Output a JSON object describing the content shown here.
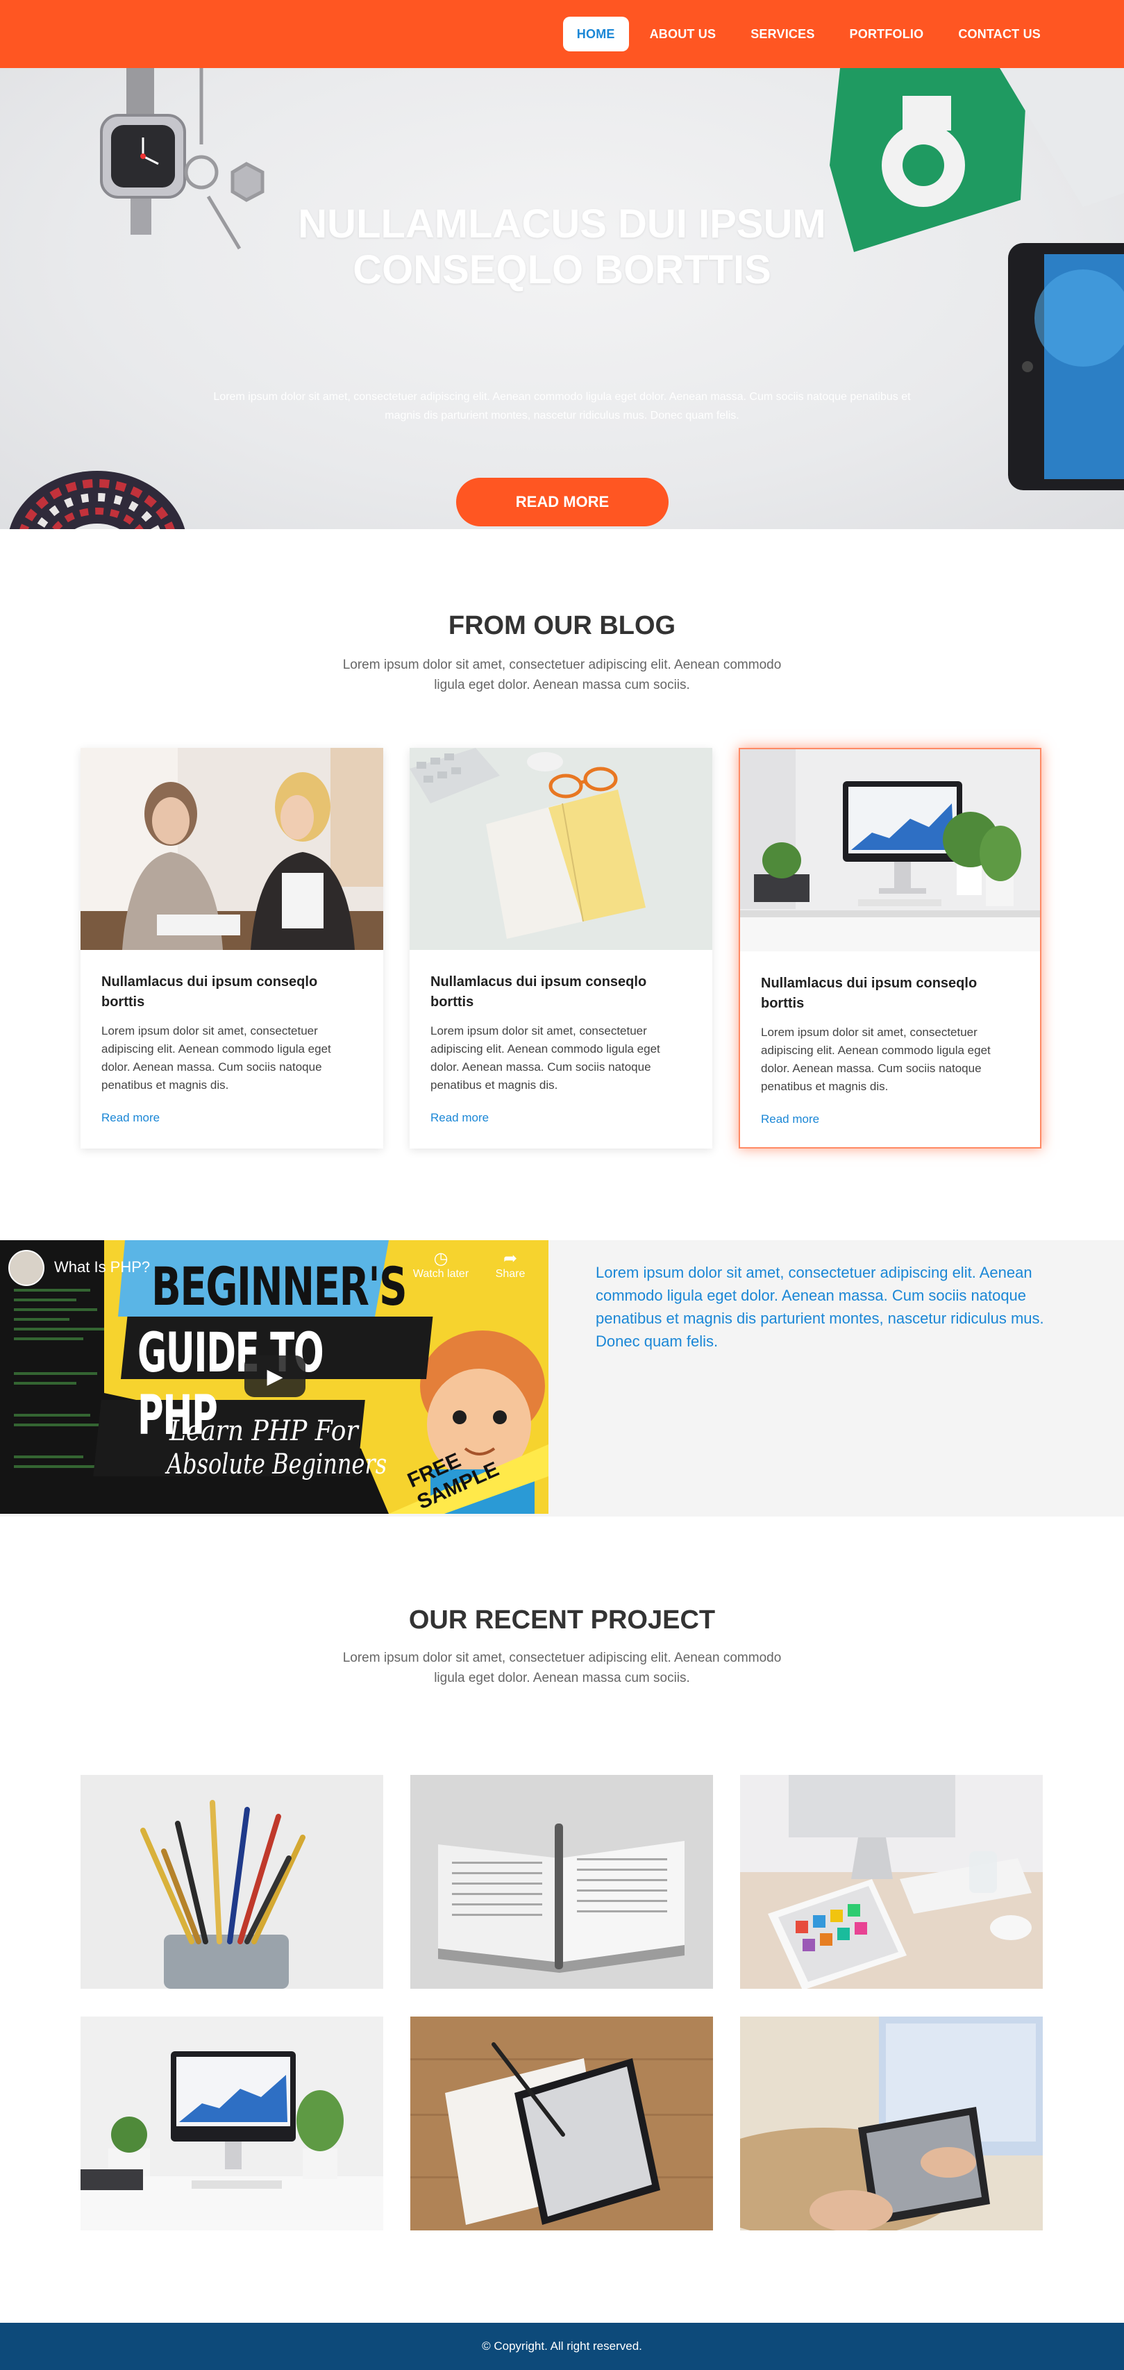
{
  "nav": {
    "items": [
      {
        "label": "HOME",
        "active": true
      },
      {
        "label": "ABOUT US"
      },
      {
        "label": "SERVICES"
      },
      {
        "label": "PORTFOLIO"
      },
      {
        "label": "CONTACT US"
      }
    ]
  },
  "hero": {
    "title_line1": "NULLAMLACUS DUI IPSUM",
    "title_line2": "CONSEQLO BORTTIS",
    "subtitle": "Lorem ipsum dolor sit amet, consectetuer adipiscing elit. Aenean commodo ligula eget dolor. Aenean massa. Cum sociis natoque penatibus et magnis dis parturient montes, nascetur ridiculus mus. Donec quam felis.",
    "button": "READ MORE"
  },
  "blog": {
    "title": "FROM OUR BLOG",
    "subtitle": "Lorem ipsum dolor sit amet, consectetuer adipiscing elit. Aenean commodo ligula eget dolor. Aenean massa cum sociis.",
    "cards": [
      {
        "title": "Nullamlacus dui ipsum conseqlo borttis",
        "text": "Lorem ipsum dolor sit amet, consectetuer adipiscing elit. Aenean commodo ligula eget dolor. Aenean massa. Cum sociis natoque penatibus et magnis dis.",
        "link": "Read more"
      },
      {
        "title": "Nullamlacus dui ipsum conseqlo borttis",
        "text": "Lorem ipsum dolor sit amet, consectetuer adipiscing elit. Aenean commodo ligula eget dolor. Aenean massa. Cum sociis natoque penatibus et magnis dis.",
        "link": "Read more"
      },
      {
        "title": "Nullamlacus dui ipsum conseqlo borttis",
        "text": "Lorem ipsum dolor sit amet, consectetuer adipiscing elit. Aenean commodo ligula eget dolor. Aenean massa. Cum sociis natoque penatibus et magnis dis.",
        "link": "Read more"
      }
    ]
  },
  "video": {
    "title": "What Is PHP?",
    "watch_later": "Watch later",
    "share": "Share",
    "thumb_line1": "BEGINNER'S",
    "thumb_line2": "GUIDE TO PHP",
    "thumb_script1": "Learn PHP For",
    "thumb_script2": "Absolute Beginners",
    "thumb_ribbon": "FREE SAMPLE",
    "description": "Lorem ipsum dolor sit amet, consectetuer adipiscing elit. Aenean commodo ligula eget dolor. Aenean massa. Cum sociis natoque penatibus et magnis dis parturient montes, nascetur ridiculus mus. Donec quam felis."
  },
  "projects": {
    "title": "OUR RECENT PROJECT",
    "subtitle": "Lorem ipsum dolor sit amet, consectetuer adipiscing elit. Aenean commodo ligula eget dolor. Aenean massa cum sociis."
  },
  "footer": {
    "copyright": "© Copyright. All right reserved."
  },
  "colors": {
    "accent": "#ff5622",
    "link": "#1b87d6",
    "footer": "#0d4a7a"
  }
}
